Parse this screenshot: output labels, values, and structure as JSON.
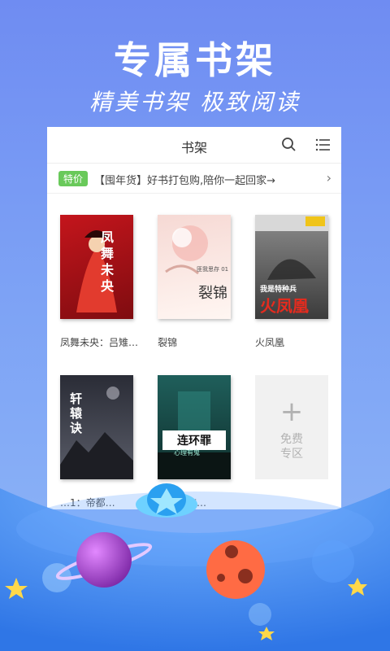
{
  "promo_header": {
    "title": "专属书架",
    "subtitle": "精美书架  极致阅读"
  },
  "app": {
    "title": "书架",
    "icons": {
      "search": "search-icon",
      "menu": "list-menu-icon",
      "arrow": "chevron-right-icon"
    },
    "promo": {
      "tag": "特价",
      "text": "【囤年货】好书打包购,陪你一起回家→"
    },
    "books": [
      {
        "title": "凤舞未央：吕雉…",
        "cover_text": "凤舞未央"
      },
      {
        "title": "裂锦",
        "cover_text": "裂锦",
        "cover_subtext": "匪我思存 01"
      },
      {
        "title": "火凤凰",
        "cover_text": "火凤凰",
        "cover_subtext": "我是特种兵"
      },
      {
        "title": "…1：帝都…",
        "cover_text": "轩辕诀"
      },
      {
        "title": "…心理有…",
        "cover_text": "连环罪",
        "cover_subtext": "心理有鬼"
      }
    ],
    "free_zone": {
      "plus": "+",
      "label": "免费\n专区"
    }
  },
  "colors": {
    "bg_top": "#6f8cf2",
    "accent_green": "#69c95a",
    "planet": "#b14fd1"
  }
}
